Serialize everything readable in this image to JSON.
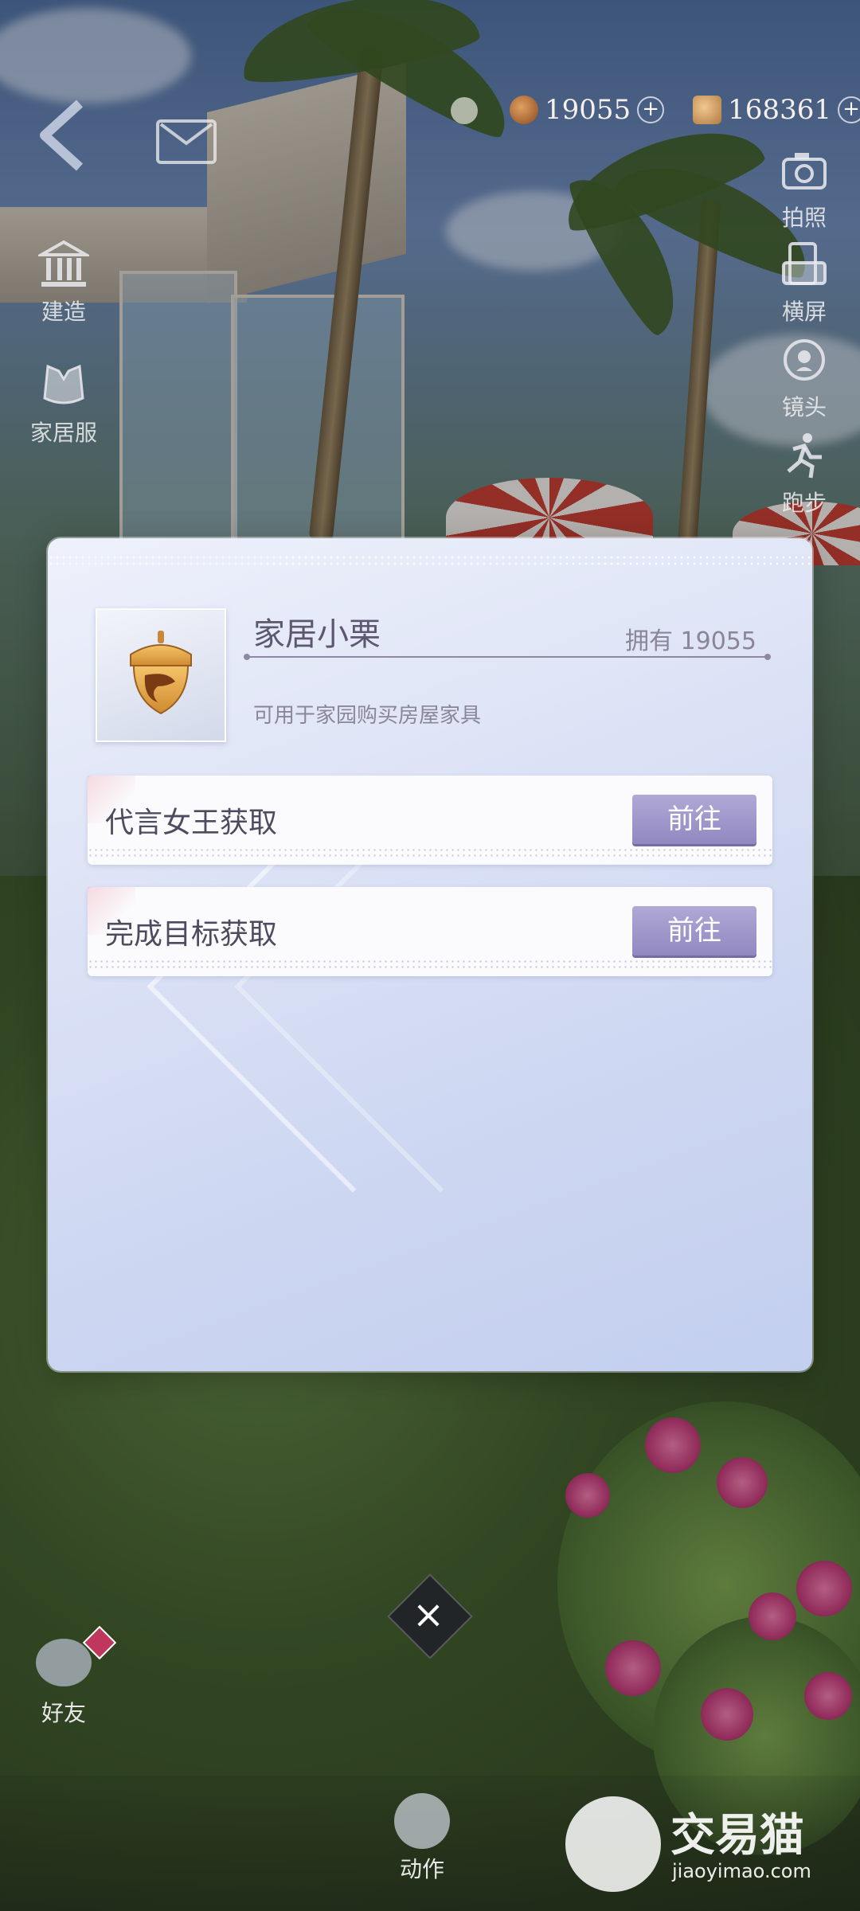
{
  "currencies": [
    {
      "value": "19055",
      "icon": "acorn-icon",
      "plus": "+"
    },
    {
      "value": "168361",
      "icon": "crystal-icon",
      "plus": "+"
    }
  ],
  "left_menu": [
    {
      "label": "建造",
      "icon": "build-icon"
    },
    {
      "label": "家居服",
      "icon": "outfit-icon"
    }
  ],
  "right_menu": [
    {
      "label": "拍照",
      "icon": "camera-icon"
    },
    {
      "label": "横屏",
      "icon": "rotate-screen-icon"
    },
    {
      "label": "镜头",
      "icon": "lens-icon"
    },
    {
      "label": "跑步",
      "icon": "run-icon"
    }
  ],
  "item": {
    "name": "家居小栗",
    "owned": "拥有 19055",
    "description": "可用于家园购买房屋家具"
  },
  "sources": [
    {
      "label": "代言女王获取",
      "button": "前往"
    },
    {
      "label": "完成目标获取",
      "button": "前往"
    }
  ],
  "close": "×",
  "bottom": {
    "friends": "好友",
    "action": "动作"
  },
  "watermark": {
    "title": "交易猫",
    "url": "jiaoyimao.com"
  },
  "colors": {
    "button": "#9d95ca",
    "modal_bg": "#dde3f6",
    "text_dark": "#4d4b5e"
  }
}
